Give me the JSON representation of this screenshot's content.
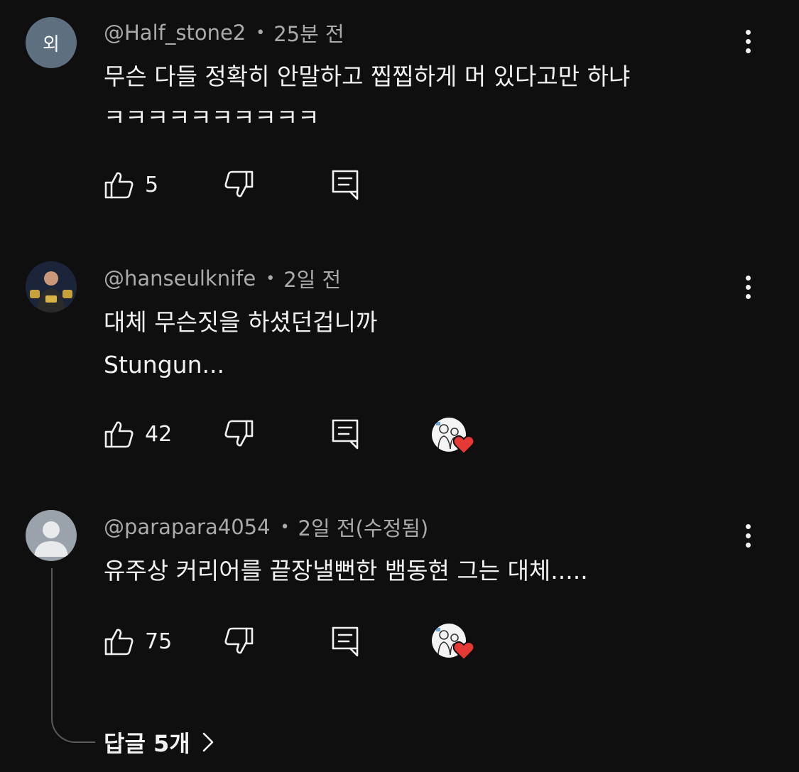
{
  "comments": [
    {
      "avatar_letter": "외",
      "author": "@Half_stone2",
      "time": "25분 전",
      "lines": [
        "무슨 다들 정확히 안말하고 찝찝하게 머 있다고만 하냐",
        "ㅋㅋㅋㅋㅋㅋㅋㅋㅋㅋ"
      ],
      "likes": "5"
    },
    {
      "author": "@hanseulknife",
      "time": "2일 전",
      "lines": [
        "대체 무슨짓을 하셨던겁니까",
        "Stungun..."
      ],
      "likes": "42"
    },
    {
      "author": "@parapara4054",
      "time": "2일 전(수정됨)",
      "lines": [
        "유주상 커리어를 끝장낼뻔한 뱀동현 그는 대체....."
      ],
      "likes": "75"
    }
  ],
  "replies_label": "답글 5개",
  "colors": {
    "background": "#0f0f0f",
    "text": "#f1f1f1",
    "meta": "#aaaaaa",
    "heart": "#e53935"
  },
  "icons": [
    "thumb-up-icon",
    "thumb-down-icon",
    "reply-icon",
    "more-vert-icon",
    "heart-icon",
    "chevron-right-icon"
  ]
}
